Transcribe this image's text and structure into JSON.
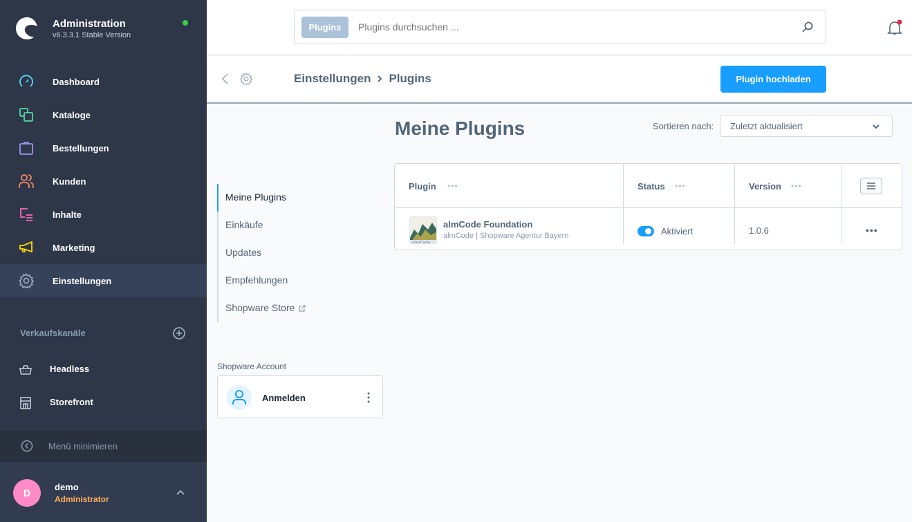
{
  "app": {
    "title": "Administration",
    "version": "v6.3.3.1 Stable Version",
    "status_color": "#37d046"
  },
  "sidebar": {
    "items": [
      {
        "label": "Dashboard",
        "icon": "dashboard-icon",
        "color": "#57d9f5"
      },
      {
        "label": "Kataloge",
        "icon": "catalog-icon",
        "color": "#57d9a3"
      },
      {
        "label": "Bestellungen",
        "icon": "shopping-bag-icon",
        "color": "#a092f0"
      },
      {
        "label": "Kunden",
        "icon": "users-icon",
        "color": "#f88962"
      },
      {
        "label": "Inhalte",
        "icon": "content-icon",
        "color": "#ff68b4"
      },
      {
        "label": "Marketing",
        "icon": "megaphone-icon",
        "color": "#ffd700"
      },
      {
        "label": "Einstellungen",
        "icon": "gear-icon",
        "color": "#9aa8b5",
        "active": true
      }
    ],
    "sales_channels_title": "Verkaufskanäle",
    "channels": [
      {
        "label": "Headless",
        "icon": "basket-icon"
      },
      {
        "label": "Storefront",
        "icon": "storefront-icon"
      }
    ],
    "minimize_label": "Menü minimieren",
    "user": {
      "initial": "D",
      "name": "demo",
      "role": "Administrator"
    }
  },
  "topbar": {
    "search_tag": "Plugins",
    "search_placeholder": "Plugins durchsuchen ...",
    "notification_dot": true
  },
  "smartbar": {
    "breadcrumb": [
      "Einstellungen",
      "Plugins"
    ],
    "upload_button": "Plugin hochladen"
  },
  "side_nav": {
    "items": [
      {
        "label": "Meine Plugins",
        "active": true
      },
      {
        "label": "Einkäufe"
      },
      {
        "label": "Updates"
      },
      {
        "label": "Empfehlungen"
      },
      {
        "label": "Shopware Store",
        "external": true
      }
    ],
    "account_label": "Shopware Account",
    "account_action": "Anmelden"
  },
  "main": {
    "title": "Meine Plugins",
    "sort_label": "Sortieren nach:",
    "sort_value": "Zuletzt aktualisiert",
    "columns": [
      "Plugin",
      "Status",
      "Version"
    ],
    "rows": [
      {
        "name": "almCode Foundation",
        "author": "almCode | Shopware Agentur Bayern",
        "active": true,
        "status": "Aktiviert",
        "version": "1.0.6"
      }
    ]
  }
}
